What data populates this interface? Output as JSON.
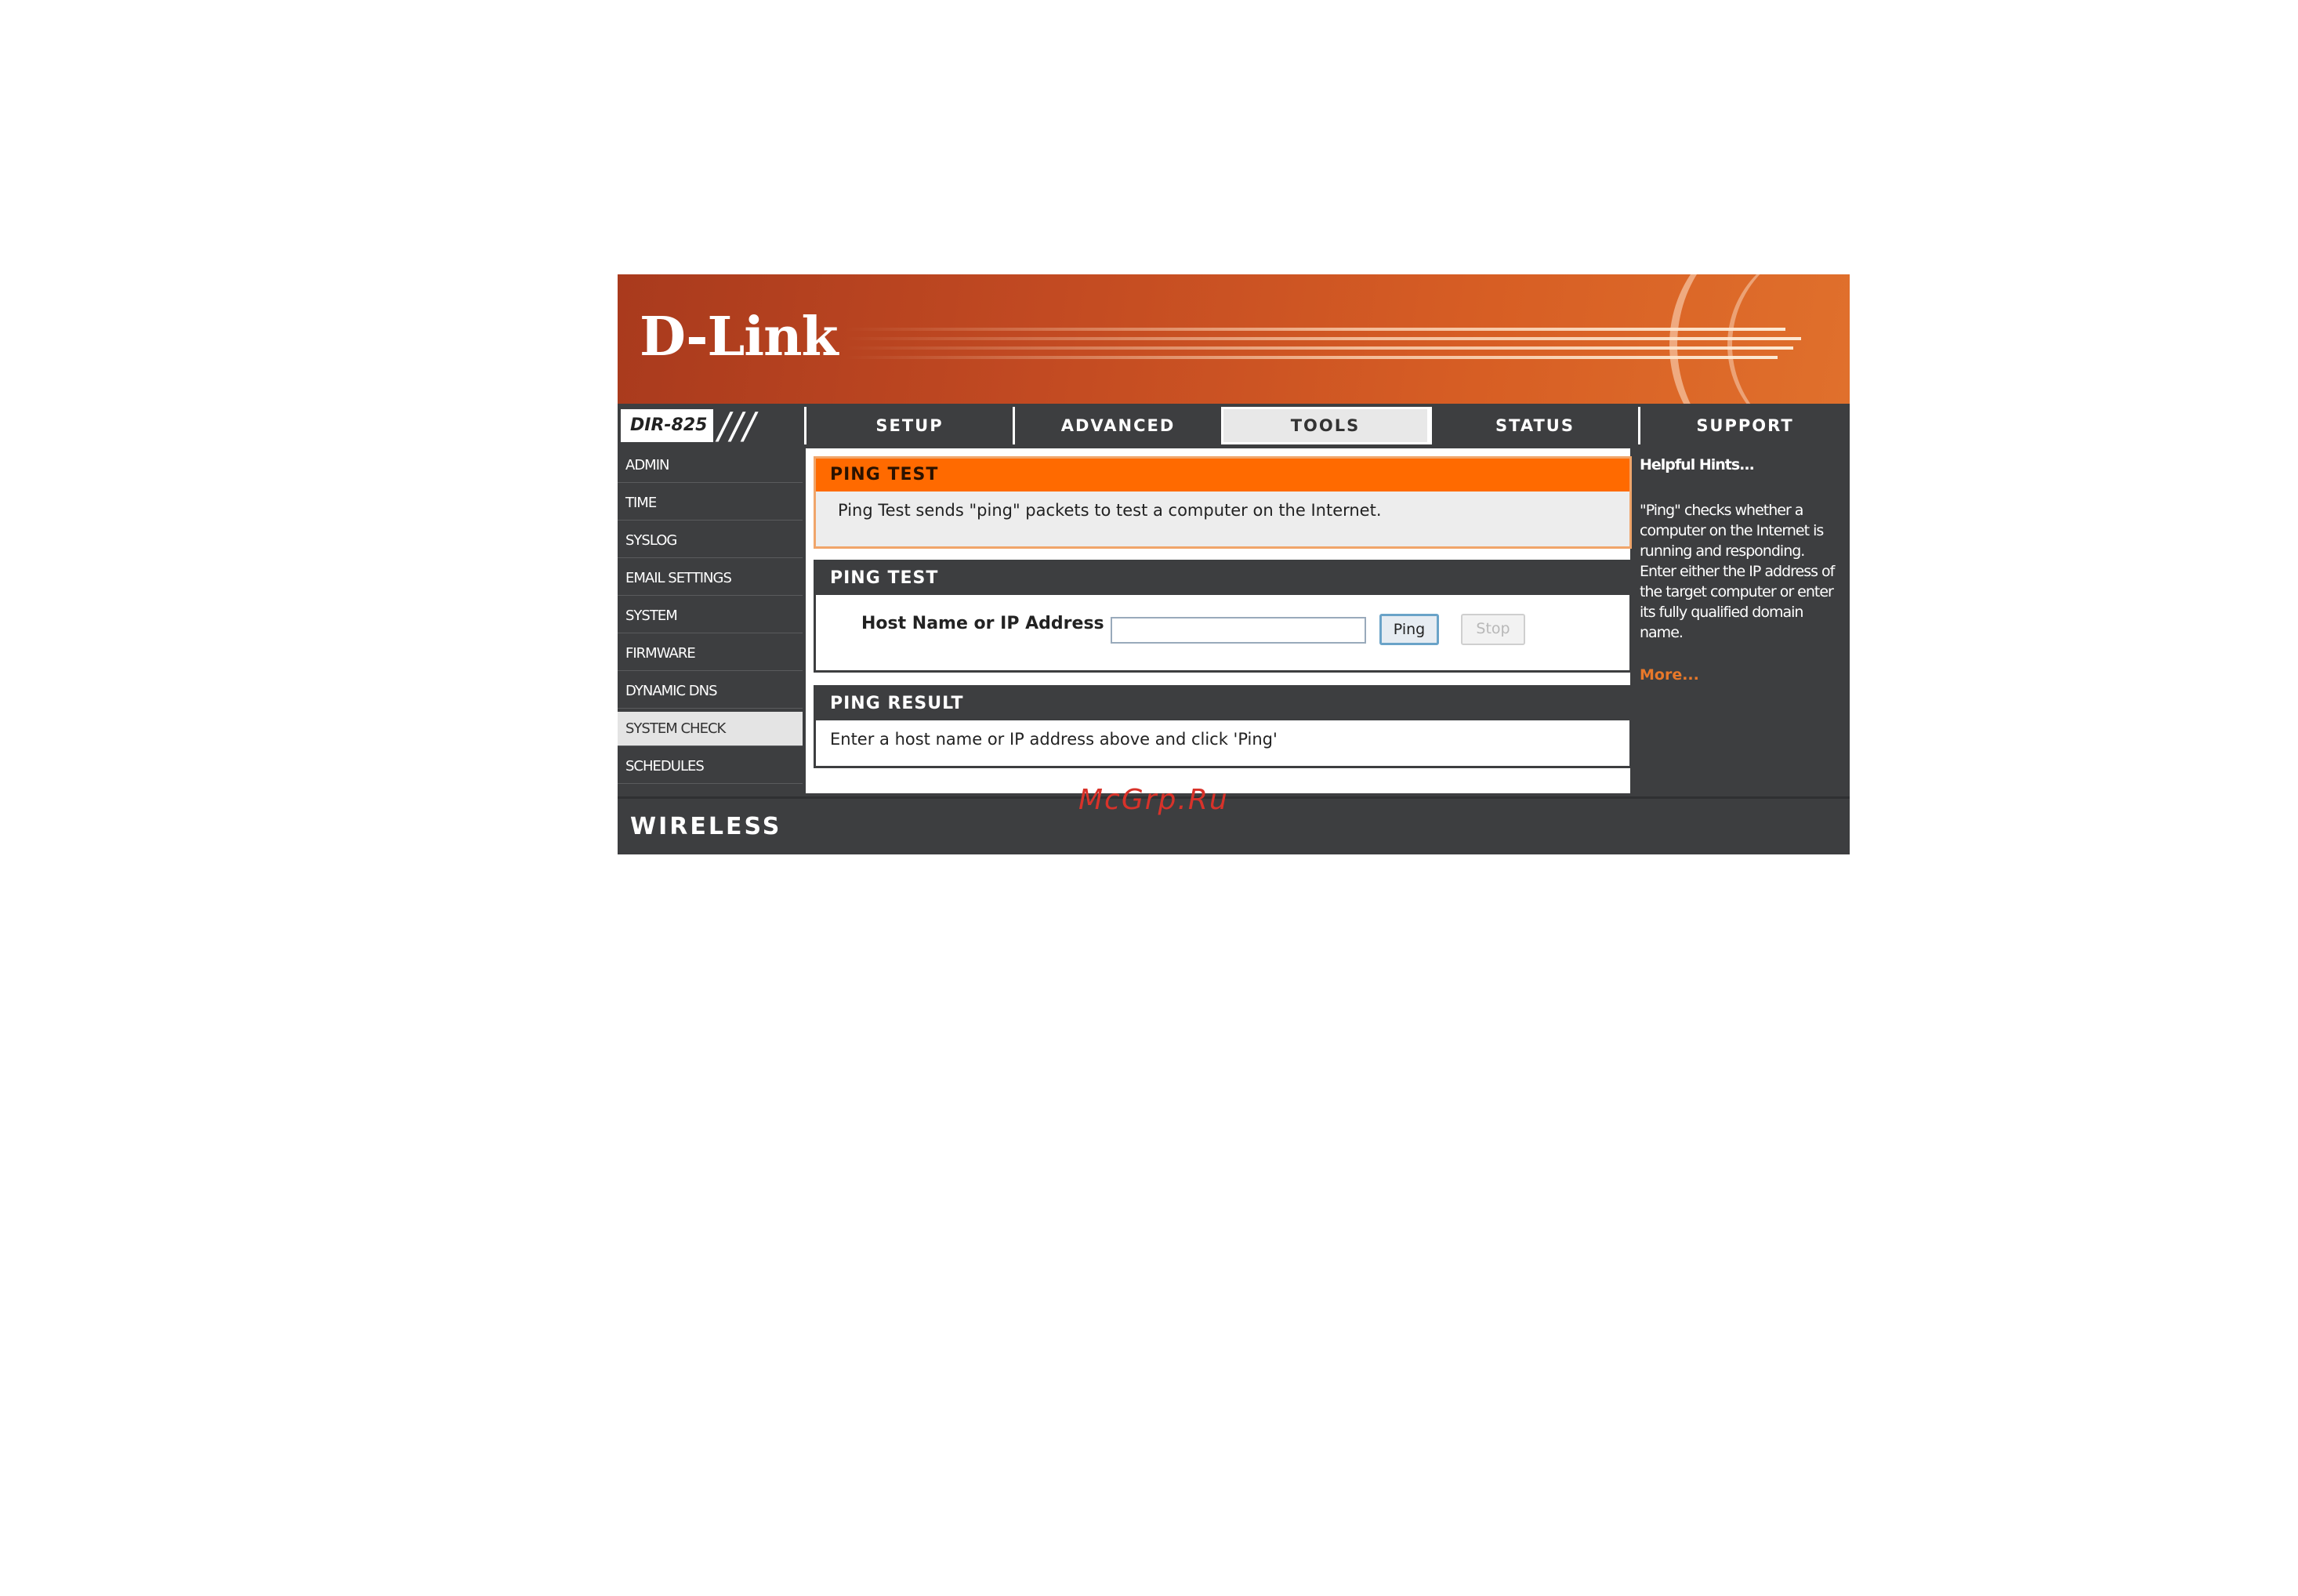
{
  "brand": {
    "logo": "D-Link",
    "model": "DIR-825"
  },
  "tabs": [
    {
      "label": "SETUP",
      "active": false
    },
    {
      "label": "ADVANCED",
      "active": false
    },
    {
      "label": "TOOLS",
      "active": true
    },
    {
      "label": "STATUS",
      "active": false
    },
    {
      "label": "SUPPORT",
      "active": false
    }
  ],
  "sidebar": {
    "items": [
      {
        "label": "ADMIN",
        "active": false
      },
      {
        "label": "TIME",
        "active": false
      },
      {
        "label": "SYSLOG",
        "active": false
      },
      {
        "label": "EMAIL SETTINGS",
        "active": false
      },
      {
        "label": "SYSTEM",
        "active": false
      },
      {
        "label": "FIRMWARE",
        "active": false
      },
      {
        "label": "DYNAMIC DNS",
        "active": false
      },
      {
        "label": "SYSTEM CHECK",
        "active": true
      },
      {
        "label": "SCHEDULES",
        "active": false
      }
    ]
  },
  "intro": {
    "header": "PING TEST",
    "description": "Ping Test sends \"ping\" packets to test a computer on the Internet."
  },
  "ping_test": {
    "header": "PING TEST",
    "host_label": "Host Name or IP Address :",
    "host_value": "",
    "ping_button": "Ping",
    "stop_button": "Stop"
  },
  "ping_result": {
    "header": "PING RESULT",
    "text": "Enter a host name or IP address above and click 'Ping'"
  },
  "help": {
    "title": "Helpful Hints...",
    "text": "\"Ping\" checks whether a computer on the Internet is running and responding. Enter either the IP address of the target computer or enter its fully qualified domain name.",
    "more": "More..."
  },
  "footer": {
    "label": "WIRELESS"
  },
  "watermark": "McGrp.Ru",
  "colors": {
    "accent_orange": "#ff6a00",
    "dark_gray": "#3d3e40",
    "more_link": "#e8782a"
  }
}
